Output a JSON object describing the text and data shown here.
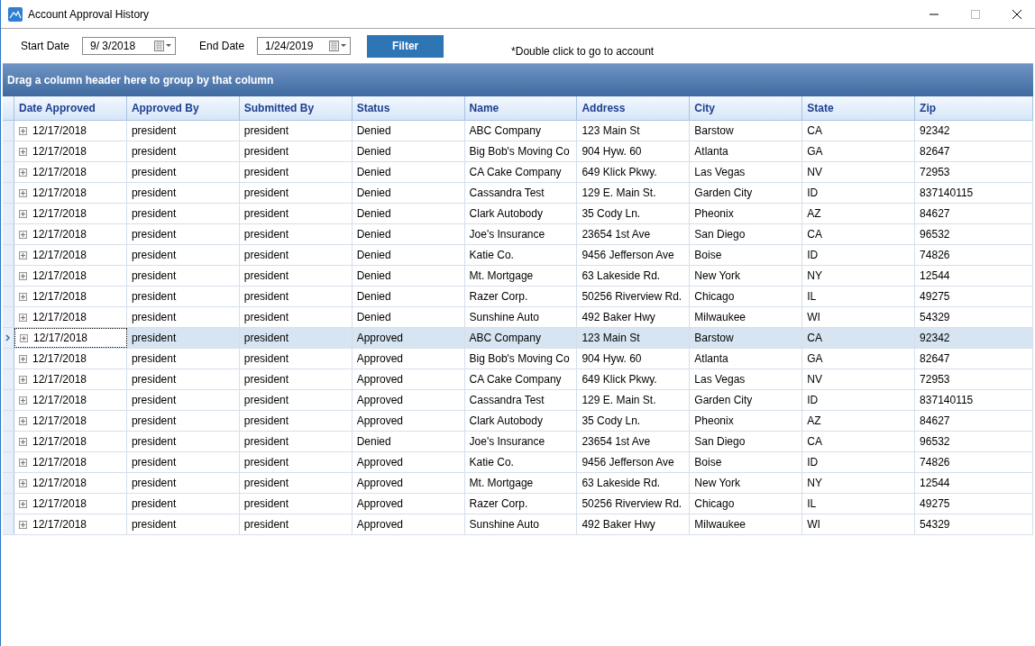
{
  "window": {
    "title": "Account Approval History"
  },
  "filters": {
    "start_label": "Start Date",
    "start_value": "9/  3/2018",
    "end_label": "End Date",
    "end_value": "1/24/2019",
    "button": "Filter",
    "hint": "*Double click to go to account"
  },
  "group_panel": "Drag a column header here to group by that column",
  "columns": [
    "Date Approved",
    "Approved By",
    "Submitted By",
    "Status",
    "Name",
    "Address",
    "City",
    "State",
    "Zip"
  ],
  "rows": [
    {
      "selected": false,
      "cells": [
        "12/17/2018",
        "president",
        "president",
        "Denied",
        "ABC Company",
        "123 Main St",
        "Barstow",
        "CA",
        "92342"
      ]
    },
    {
      "selected": false,
      "cells": [
        "12/17/2018",
        "president",
        "president",
        "Denied",
        "Big Bob's Moving Co",
        "904 Hyw. 60",
        "Atlanta",
        "GA",
        "82647"
      ]
    },
    {
      "selected": false,
      "cells": [
        "12/17/2018",
        "president",
        "president",
        "Denied",
        "CA Cake Company",
        "649 Klick Pkwy.",
        "Las Vegas",
        "NV",
        "72953"
      ]
    },
    {
      "selected": false,
      "cells": [
        "12/17/2018",
        "president",
        "president",
        "Denied",
        "Cassandra Test",
        "129 E. Main St.",
        "Garden City",
        "ID",
        "837140115"
      ]
    },
    {
      "selected": false,
      "cells": [
        "12/17/2018",
        "president",
        "president",
        "Denied",
        "Clark Autobody",
        "35 Cody Ln.",
        "Pheonix",
        "AZ",
        "84627"
      ]
    },
    {
      "selected": false,
      "cells": [
        "12/17/2018",
        "president",
        "president",
        "Denied",
        "Joe's Insurance",
        "23654 1st Ave",
        "San Diego",
        "CA",
        "96532"
      ]
    },
    {
      "selected": false,
      "cells": [
        "12/17/2018",
        "president",
        "president",
        "Denied",
        "Katie Co.",
        "9456 Jefferson Ave",
        "Boise",
        "ID",
        "74826"
      ]
    },
    {
      "selected": false,
      "cells": [
        "12/17/2018",
        "president",
        "president",
        "Denied",
        "Mt. Mortgage",
        "63 Lakeside Rd.",
        "New York",
        "NY",
        "12544"
      ]
    },
    {
      "selected": false,
      "cells": [
        "12/17/2018",
        "president",
        "president",
        "Denied",
        "Razer Corp.",
        "50256 Riverview Rd.",
        "Chicago",
        "IL",
        "49275"
      ]
    },
    {
      "selected": false,
      "cells": [
        "12/17/2018",
        "president",
        "president",
        "Denied",
        "Sunshine Auto",
        "492 Baker Hwy",
        "Milwaukee",
        "WI",
        "54329"
      ]
    },
    {
      "selected": true,
      "cells": [
        "12/17/2018",
        "president",
        "president",
        "Approved",
        "ABC Company",
        "123 Main St",
        "Barstow",
        "CA",
        "92342"
      ]
    },
    {
      "selected": false,
      "cells": [
        "12/17/2018",
        "president",
        "president",
        "Approved",
        "Big Bob's Moving Co",
        "904 Hyw. 60",
        "Atlanta",
        "GA",
        "82647"
      ]
    },
    {
      "selected": false,
      "cells": [
        "12/17/2018",
        "president",
        "president",
        "Approved",
        "CA Cake Company",
        "649 Klick Pkwy.",
        "Las Vegas",
        "NV",
        "72953"
      ]
    },
    {
      "selected": false,
      "cells": [
        "12/17/2018",
        "president",
        "president",
        "Approved",
        "Cassandra Test",
        "129 E. Main St.",
        "Garden City",
        "ID",
        "837140115"
      ]
    },
    {
      "selected": false,
      "cells": [
        "12/17/2018",
        "president",
        "president",
        "Approved",
        "Clark Autobody",
        "35 Cody Ln.",
        "Pheonix",
        "AZ",
        "84627"
      ]
    },
    {
      "selected": false,
      "cells": [
        "12/17/2018",
        "president",
        "president",
        "Denied",
        "Joe's Insurance",
        "23654 1st Ave",
        "San Diego",
        "CA",
        "96532"
      ]
    },
    {
      "selected": false,
      "cells": [
        "12/17/2018",
        "president",
        "president",
        "Approved",
        "Katie Co.",
        "9456 Jefferson Ave",
        "Boise",
        "ID",
        "74826"
      ]
    },
    {
      "selected": false,
      "cells": [
        "12/17/2018",
        "president",
        "president",
        "Approved",
        "Mt. Mortgage",
        "63 Lakeside Rd.",
        "New York",
        "NY",
        "12544"
      ]
    },
    {
      "selected": false,
      "cells": [
        "12/17/2018",
        "president",
        "president",
        "Approved",
        "Razer Corp.",
        "50256 Riverview Rd.",
        "Chicago",
        "IL",
        "49275"
      ]
    },
    {
      "selected": false,
      "cells": [
        "12/17/2018",
        "president",
        "president",
        "Approved",
        "Sunshine Auto",
        "492 Baker Hwy",
        "Milwaukee",
        "WI",
        "54329"
      ]
    }
  ]
}
